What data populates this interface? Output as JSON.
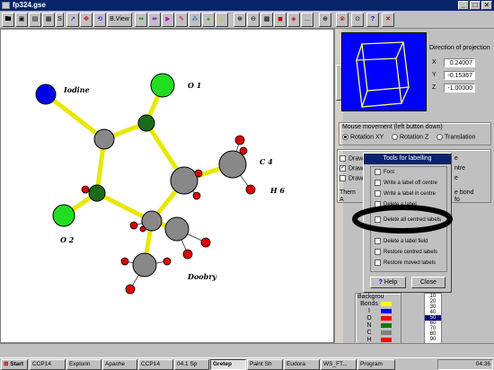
{
  "window": {
    "title": "fp324.gse"
  },
  "toolbar": {
    "bview_label": "B.View",
    "dots": "..."
  },
  "molecule": {
    "labels": {
      "iodine": "Iodine",
      "o1": "O 1",
      "o2": "O 2",
      "c4": "C 4",
      "h6": "H 6",
      "doobry": "Doobry"
    }
  },
  "projection": {
    "heading": "Direction of projection",
    "x_label": "X",
    "x_value": "0.24007",
    "y_label": "Y",
    "y_value": "-0.15367",
    "z_label": "Z",
    "z_value": "-1.00000"
  },
  "mouse": {
    "heading": "Mouse movement (left button down)",
    "opt_xy": "Rotation XY",
    "opt_z": "Rotation Z",
    "opt_t": "Translation"
  },
  "draw": {
    "opt1": "Draw",
    "opt2": "Draw",
    "opt3": "Draw",
    "them": "Them",
    "a": "A",
    "frag_e": "e",
    "frag_ntre": "ntre",
    "frag_e2": "e",
    "frag_bond": "e bond",
    "frag_fo": "fo"
  },
  "dialog": {
    "title": "Tools for labelling",
    "items": [
      "Font",
      "Write a label off centre",
      "Write a label in centre",
      "Delete a label",
      "Delete all centred labels",
      "Delete a label field",
      "Restore centred labels",
      "Restore moved labels"
    ],
    "help": "Help",
    "close": "Close"
  },
  "legend": {
    "header": "Backgrou",
    "items": [
      "Bonds",
      "I",
      "O",
      "N",
      "C",
      "H"
    ],
    "colors": [
      "#ffff00",
      "#0000ff",
      "#ff0000",
      "#008000",
      "#808080",
      "#ff0000"
    ]
  },
  "sizes": {
    "items": [
      "10",
      "20",
      "30",
      "40",
      "50",
      "60",
      "70",
      "80",
      "90"
    ],
    "selected": "50"
  },
  "taskbar": {
    "start": "Start",
    "tasks": [
      "CCP14",
      "Explorin",
      "Apache",
      "CCP14",
      "04.1 Sp",
      "Gretep",
      "Paint Sh",
      "Eudora",
      "WS_FT...",
      "Program"
    ],
    "time": "04:36"
  }
}
